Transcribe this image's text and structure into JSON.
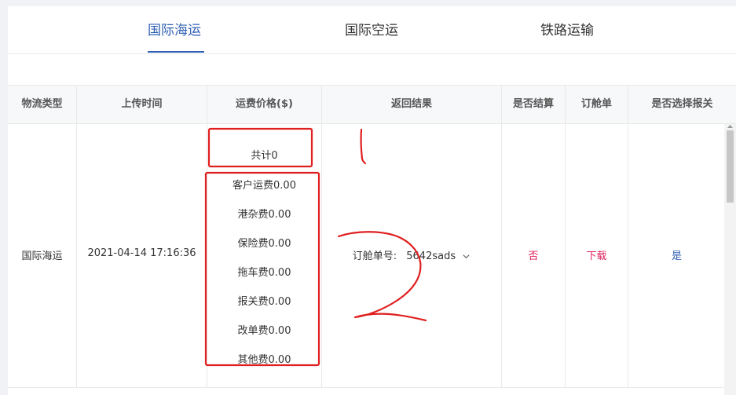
{
  "tabs": [
    {
      "label": "国际海运",
      "active": true
    },
    {
      "label": "国际空运",
      "active": false
    },
    {
      "label": "铁路运输",
      "active": false
    }
  ],
  "table": {
    "headers": [
      "物流类型",
      "上传时间",
      "运费价格($)",
      "返回结果",
      "是否结算",
      "订舱单",
      "是否选择报关"
    ],
    "row": {
      "logistics_type": "国际海运",
      "upload_time": "2021-04-14 17:16:36",
      "total": "共计0",
      "fees": [
        "客户运费0.00",
        "港杂费0.00",
        "保险费0.00",
        "拖车费0.00",
        "报关费0.00",
        "改单费0.00",
        "其他费0.00"
      ],
      "booking_label": "订舱单号:",
      "booking_number": "5642sads",
      "settled": "否",
      "booking_doc": "下载",
      "customs": "是"
    }
  },
  "colors": {
    "accent": "#2f5fb3",
    "link_red": "#e0245e",
    "annotation_red": "#e02020"
  },
  "icons": {
    "dropdown": "chevron-down-icon",
    "scroll_up": "scroll-up-arrow-icon"
  }
}
